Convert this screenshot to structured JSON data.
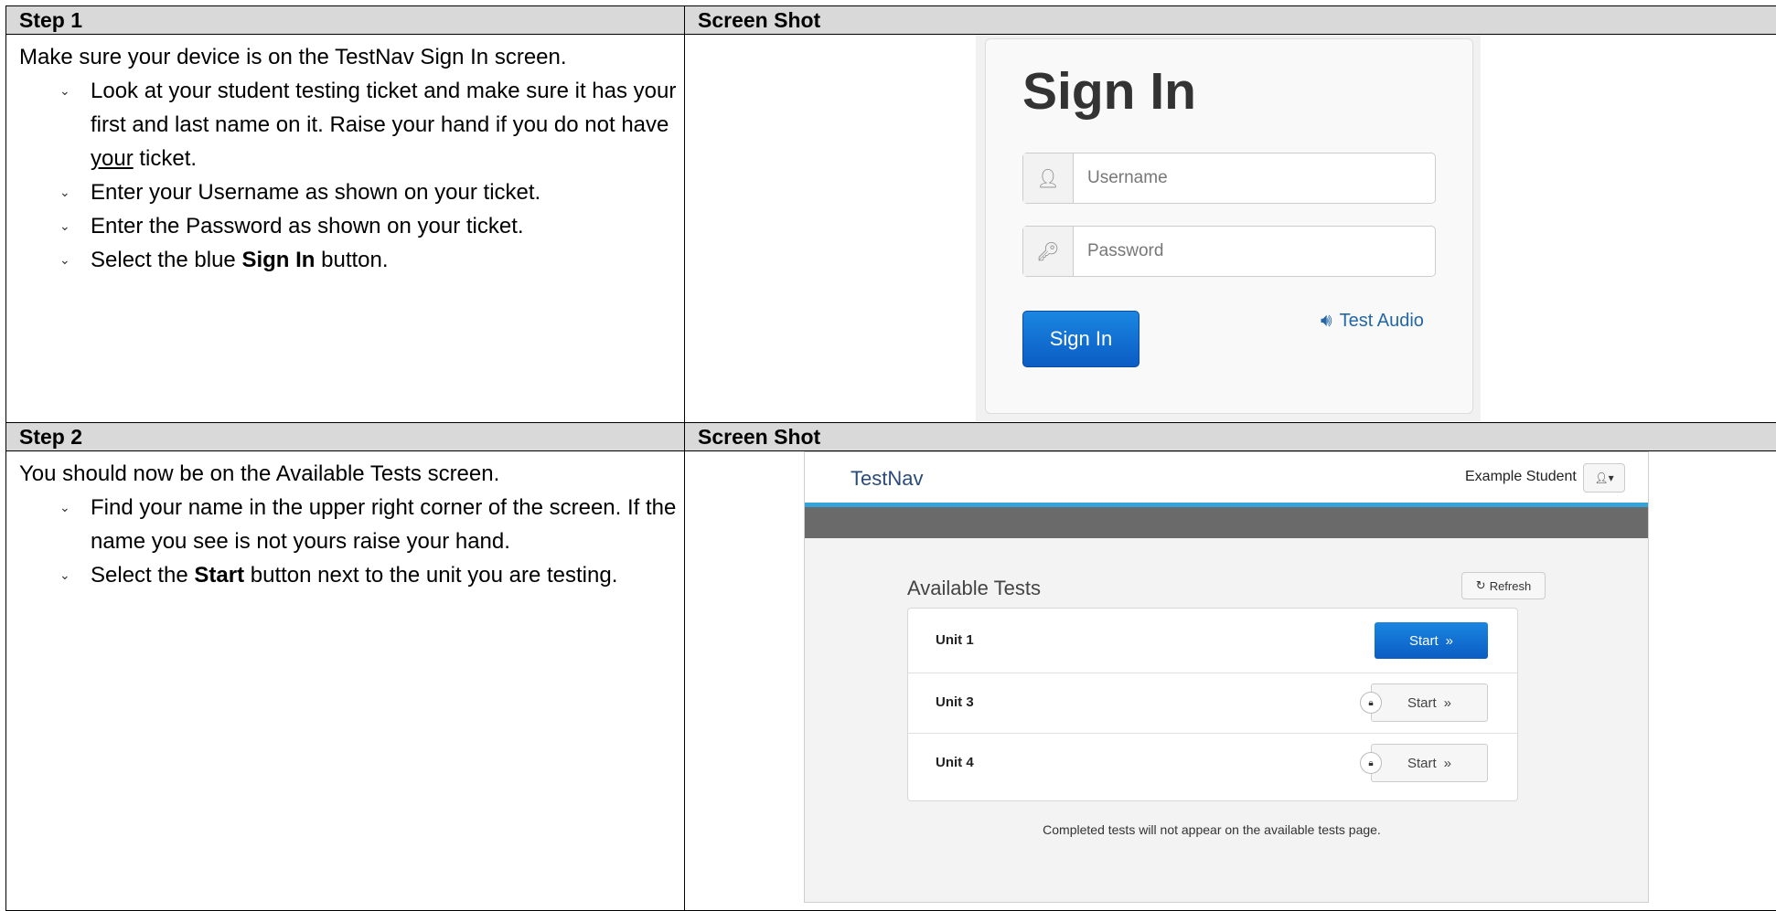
{
  "steps": [
    {
      "label": "Step 1",
      "screenshot_label": "Screen Shot",
      "intro": "Make sure your device is on the TestNav Sign In screen.",
      "bullets": [
        {
          "text": "Look at your student testing ticket and make sure it has your first and last name on it. Raise your hand if you do not have ",
          "underline": "your",
          "after": " ticket."
        },
        {
          "text": "Enter your Username as shown on your ticket."
        },
        {
          "text": "Enter the Password as shown on your ticket."
        },
        {
          "before": "Select the blue ",
          "bold": "Sign In",
          "after": " button."
        }
      ]
    },
    {
      "label": "Step 2",
      "screenshot_label": "Screen Shot",
      "intro": "You should now be on the Available Tests screen.",
      "bullets": [
        {
          "text": "Find your name in the upper right corner of the screen. If the name you see is not yours raise your hand."
        },
        {
          "before": "Select the ",
          "bold": "Start",
          "after": " button next to the unit you are testing."
        }
      ]
    }
  ],
  "signin_screen": {
    "title": "Sign In",
    "username_placeholder": "Username",
    "password_placeholder": "Password",
    "signin_button": "Sign In",
    "test_audio": "Test Audio",
    "accent_color": "#0b5cc4"
  },
  "tests_screen": {
    "logo": "TestNav",
    "user_name": "Example Student",
    "heading": "Available Tests",
    "refresh_label": "Refresh",
    "units": [
      {
        "name": "Unit 1",
        "start_label": "Start",
        "locked": false
      },
      {
        "name": "Unit 3",
        "start_label": "Start",
        "locked": true
      },
      {
        "name": "Unit 4",
        "start_label": "Start",
        "locked": true
      }
    ],
    "note": "Completed tests will not appear on the available tests page."
  }
}
